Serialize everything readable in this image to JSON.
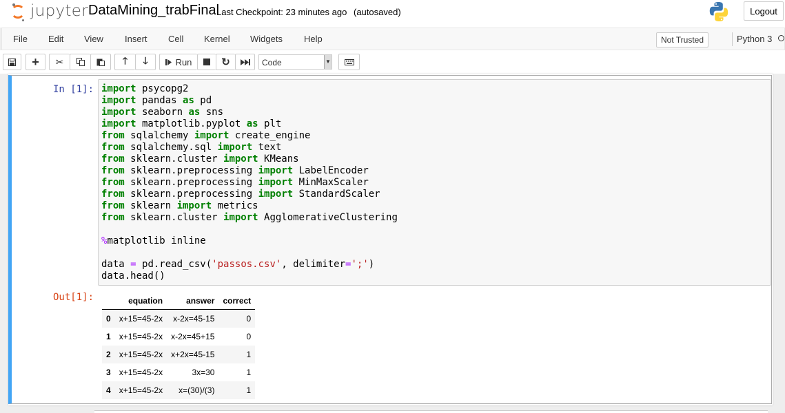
{
  "header": {
    "logo_text": "jupyter",
    "notebook_name": "DataMining_trabFinal",
    "checkpoint": "Last Checkpoint: 23 minutes ago",
    "autosave": "(autosaved)",
    "logout_label": "Logout"
  },
  "menubar": {
    "items": [
      "File",
      "Edit",
      "View",
      "Insert",
      "Cell",
      "Kernel",
      "Widgets",
      "Help"
    ],
    "not_trusted": "Not Trusted",
    "kernel": "Python 3"
  },
  "toolbar": {
    "run_label": "Run",
    "cell_type": "Code"
  },
  "cell": {
    "in_prompt": "In [1]:",
    "out_prompt": "Out[1]:",
    "code_lines": [
      "import psycopg2",
      "import pandas as pd",
      "import seaborn as sns",
      "import matplotlib.pyplot as plt",
      "from sqlalchemy import create_engine",
      "from sqlalchemy.sql import text",
      "from sklearn.cluster import KMeans",
      "from sklearn.preprocessing import LabelEncoder",
      "from sklearn.preprocessing import MinMaxScaler",
      "from sklearn.preprocessing import StandardScaler",
      "from sklearn import metrics",
      "from sklearn.cluster import AgglomerativeClustering",
      "",
      "%matplotlib inline",
      "",
      "data = pd.read_csv('passos.csv', delimiter=';')",
      "data.head()"
    ]
  },
  "output_table": {
    "columns": [
      "equation",
      "answer",
      "correct"
    ],
    "rows": [
      {
        "index": "0",
        "equation": "x+15=45-2x",
        "answer": "x-2x=45-15",
        "correct": "0"
      },
      {
        "index": "1",
        "equation": "x+15=45-2x",
        "answer": "x-2x=45+15",
        "correct": "0"
      },
      {
        "index": "2",
        "equation": "x+15=45-2x",
        "answer": "x+2x=45-15",
        "correct": "1"
      },
      {
        "index": "3",
        "equation": "x+15=45-2x",
        "answer": "3x=30",
        "correct": "1"
      },
      {
        "index": "4",
        "equation": "x+15=45-2x",
        "answer": "x=(30)/(3)",
        "correct": "1"
      }
    ]
  },
  "colors": {
    "accent": "#42a5f5",
    "in_prompt": "#303f9f",
    "out_prompt": "#d84315",
    "keyword": "#008000",
    "string": "#ba2121",
    "operator": "#aa22ff"
  }
}
